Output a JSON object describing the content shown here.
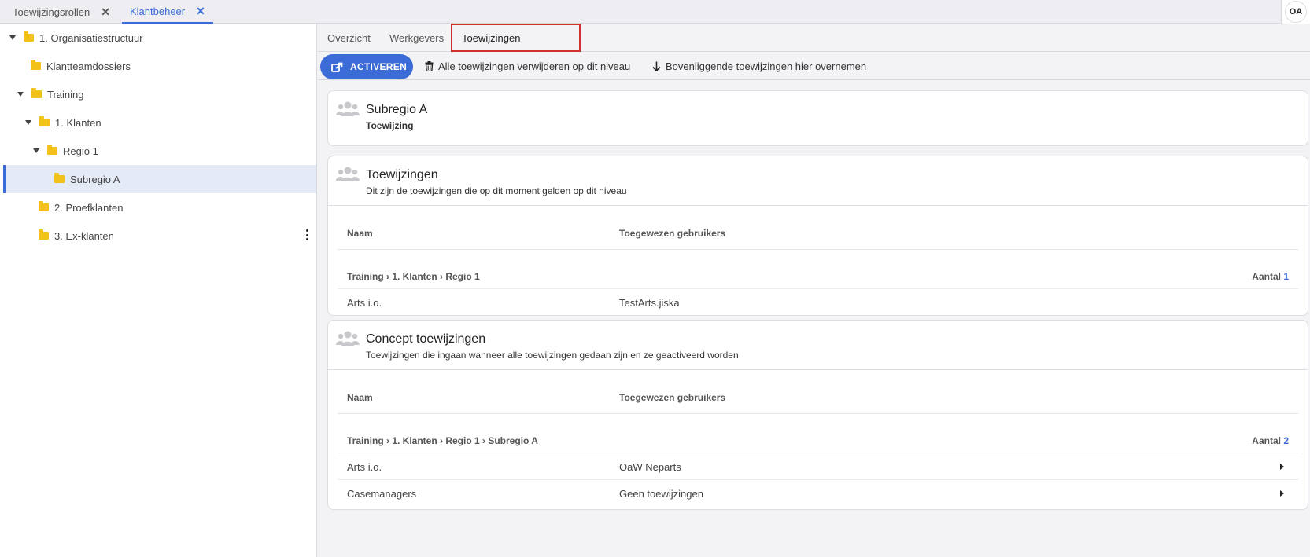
{
  "top_tabs": [
    {
      "label": "Toewijzingsrollen"
    },
    {
      "label": "Klantbeheer"
    }
  ],
  "user": {
    "initials": "OA"
  },
  "tree": [
    {
      "label": "1. Organisatiestructuur"
    },
    {
      "label": "Klantteamdossiers"
    },
    {
      "label": "Training"
    },
    {
      "label": "1. Klanten"
    },
    {
      "label": "Regio 1"
    },
    {
      "label": "Subregio A"
    },
    {
      "label": "2. Proefklanten"
    },
    {
      "label": "3. Ex-klanten"
    }
  ],
  "subtabs": [
    {
      "label": "Overzicht"
    },
    {
      "label": "Werkgevers"
    },
    {
      "label": "Toewijzingen"
    }
  ],
  "toolbar": {
    "activate_label": "ACTIVEREN",
    "remove_all_label": "Alle toewijzingen verwijderen op dit niveau",
    "take_over_label": "Bovenliggende toewijzingen hier overnemen"
  },
  "header_card": {
    "title": "Subregio A",
    "subtitle": "Toewijzing"
  },
  "current_card": {
    "title": "Toewijzingen",
    "subtitle": "Dit zijn de toewijzingen die op dit moment gelden op dit niveau",
    "col_name": "Naam",
    "col_users": "Toegewezen gebruikers",
    "group_path": "Training › 1. Klanten › Regio 1",
    "count_label": "Aantal",
    "count_value": "1",
    "rows": [
      {
        "name": "Arts i.o.",
        "users": "TestArts.jiska"
      }
    ]
  },
  "concept_card": {
    "title": "Concept toewijzingen",
    "subtitle": "Toewijzingen die ingaan wanneer alle toewijzingen gedaan zijn en ze geactiveerd worden",
    "col_name": "Naam",
    "col_users": "Toegewezen gebruikers",
    "group_path": "Training › 1. Klanten › Regio 1 › Subregio A",
    "count_label": "Aantal",
    "count_value": "2",
    "rows": [
      {
        "name": "Arts i.o.",
        "users": "OaW Neparts"
      },
      {
        "name": "Casemanagers",
        "users": "Geen toewijzingen"
      }
    ]
  },
  "colors": {
    "accent": "#3b6bd6",
    "folder": "#f2c21b",
    "highlight": "#d0312d",
    "selected_bg": "#e4ebf7"
  }
}
